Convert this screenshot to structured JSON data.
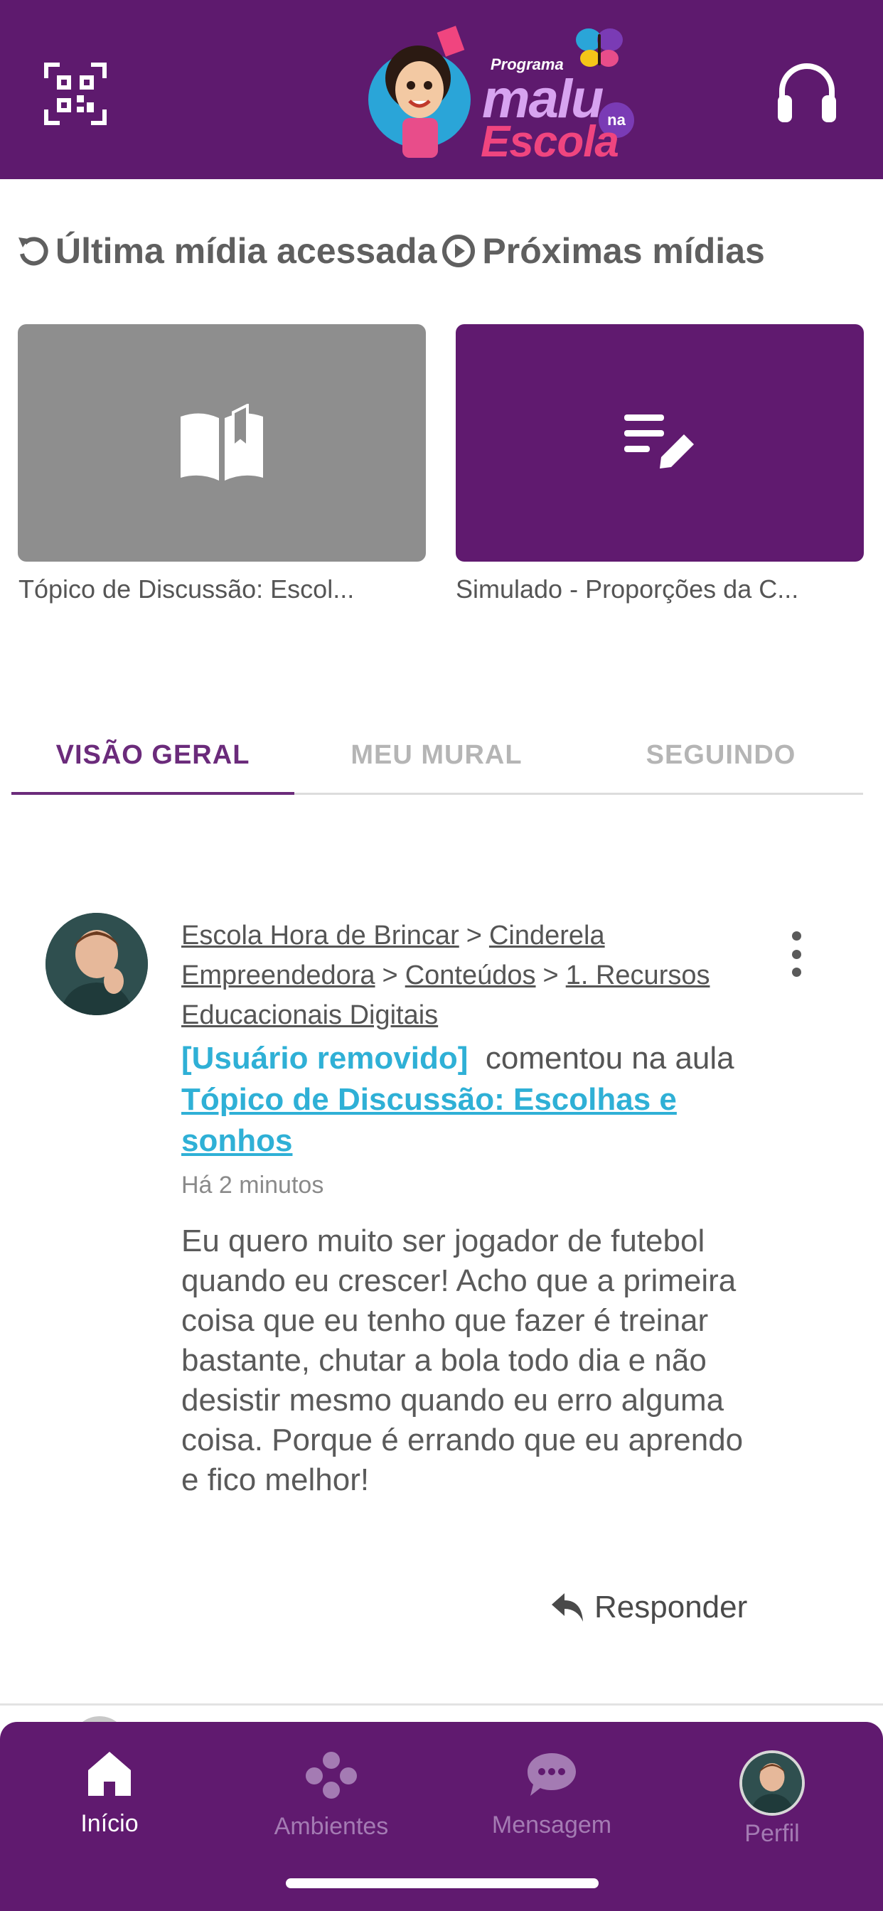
{
  "header": {
    "logo": {
      "small": "Programa",
      "malu": "malu",
      "na": "na",
      "escola": "Escola"
    },
    "qr_icon": "qr-code-icon",
    "support_icon": "headset-icon"
  },
  "media": {
    "last_title": "Última mídia acessada",
    "next_title": "Próximas mídias",
    "cards": [
      {
        "icon": "open-book-icon",
        "caption": "Tópico de Discussão: Escol...",
        "color": "#8e8e8e"
      },
      {
        "icon": "edit-list-icon",
        "caption": "Simulado - Proporções da C...",
        "color": "#601a6f"
      }
    ]
  },
  "tabs": [
    {
      "label": "VISÃO GERAL",
      "active": true
    },
    {
      "label": "MEU MURAL",
      "active": false
    },
    {
      "label": "SEGUINDO",
      "active": false
    }
  ],
  "post": {
    "breadcrumb": [
      "Escola Hora de Brincar",
      "Cinderela Empreendedora",
      "Conteúdos",
      "1. Recursos Educacionais Digitais"
    ],
    "separator": ">",
    "user": "[Usuário removido]",
    "action_text": "comentou na aula",
    "lesson": "Tópico de Discussão: Escolhas e sonhos",
    "time": "Há 2 minutos",
    "comment": "Eu quero muito ser jogador de futebol quando eu crescer! Acho que a primeira coisa que eu tenho que fazer é treinar bastante, chutar a bola todo dia e não desistir mesmo quando eu erro alguma coisa. Porque é errando que eu aprendo e fico melhor!",
    "reply_label": "Responder"
  },
  "nav": [
    {
      "label": "Início",
      "icon": "home-icon",
      "active": true
    },
    {
      "label": "Ambientes",
      "icon": "ambientes-icon",
      "active": false
    },
    {
      "label": "Mensagem",
      "icon": "chat-icon",
      "active": false
    },
    {
      "label": "Perfil",
      "icon": "profile-avatar",
      "active": false
    }
  ],
  "colors": {
    "primary": "#5e1a6e",
    "link": "#2fb0d6",
    "inactive": "#a47bb3"
  }
}
